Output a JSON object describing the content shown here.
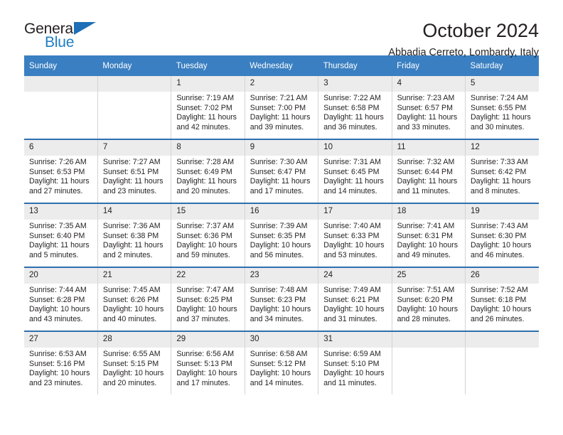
{
  "brand": {
    "name_top": "General",
    "name_bottom": "Blue",
    "triangle_color": "#1d6fb7",
    "blue_text_color": "#1d7ec4"
  },
  "header": {
    "title": "October 2024",
    "subtitle": "Abbadia Cerreto, Lombardy, Italy"
  },
  "colors": {
    "header_row_bg": "#3a7fc1",
    "header_row_text": "#ffffff",
    "daynum_bg": "#ececec",
    "row_divider": "#2f6fae",
    "text": "#231f20"
  },
  "weekday_headers": [
    "Sunday",
    "Monday",
    "Tuesday",
    "Wednesday",
    "Thursday",
    "Friday",
    "Saturday"
  ],
  "labels": {
    "sunrise_prefix": "Sunrise:",
    "sunset_prefix": "Sunset:",
    "daylight_prefix": "Daylight:"
  },
  "weeks": [
    [
      {
        "day": "",
        "lines": []
      },
      {
        "day": "",
        "lines": []
      },
      {
        "day": "1",
        "lines": [
          "Sunrise: 7:19 AM",
          "Sunset: 7:02 PM",
          "Daylight: 11 hours and 42 minutes."
        ]
      },
      {
        "day": "2",
        "lines": [
          "Sunrise: 7:21 AM",
          "Sunset: 7:00 PM",
          "Daylight: 11 hours and 39 minutes."
        ]
      },
      {
        "day": "3",
        "lines": [
          "Sunrise: 7:22 AM",
          "Sunset: 6:58 PM",
          "Daylight: 11 hours and 36 minutes."
        ]
      },
      {
        "day": "4",
        "lines": [
          "Sunrise: 7:23 AM",
          "Sunset: 6:57 PM",
          "Daylight: 11 hours and 33 minutes."
        ]
      },
      {
        "day": "5",
        "lines": [
          "Sunrise: 7:24 AM",
          "Sunset: 6:55 PM",
          "Daylight: 11 hours and 30 minutes."
        ]
      }
    ],
    [
      {
        "day": "6",
        "lines": [
          "Sunrise: 7:26 AM",
          "Sunset: 6:53 PM",
          "Daylight: 11 hours and 27 minutes."
        ]
      },
      {
        "day": "7",
        "lines": [
          "Sunrise: 7:27 AM",
          "Sunset: 6:51 PM",
          "Daylight: 11 hours and 23 minutes."
        ]
      },
      {
        "day": "8",
        "lines": [
          "Sunrise: 7:28 AM",
          "Sunset: 6:49 PM",
          "Daylight: 11 hours and 20 minutes."
        ]
      },
      {
        "day": "9",
        "lines": [
          "Sunrise: 7:30 AM",
          "Sunset: 6:47 PM",
          "Daylight: 11 hours and 17 minutes."
        ]
      },
      {
        "day": "10",
        "lines": [
          "Sunrise: 7:31 AM",
          "Sunset: 6:45 PM",
          "Daylight: 11 hours and 14 minutes."
        ]
      },
      {
        "day": "11",
        "lines": [
          "Sunrise: 7:32 AM",
          "Sunset: 6:44 PM",
          "Daylight: 11 hours and 11 minutes."
        ]
      },
      {
        "day": "12",
        "lines": [
          "Sunrise: 7:33 AM",
          "Sunset: 6:42 PM",
          "Daylight: 11 hours and 8 minutes."
        ]
      }
    ],
    [
      {
        "day": "13",
        "lines": [
          "Sunrise: 7:35 AM",
          "Sunset: 6:40 PM",
          "Daylight: 11 hours and 5 minutes."
        ]
      },
      {
        "day": "14",
        "lines": [
          "Sunrise: 7:36 AM",
          "Sunset: 6:38 PM",
          "Daylight: 11 hours and 2 minutes."
        ]
      },
      {
        "day": "15",
        "lines": [
          "Sunrise: 7:37 AM",
          "Sunset: 6:36 PM",
          "Daylight: 10 hours and 59 minutes."
        ]
      },
      {
        "day": "16",
        "lines": [
          "Sunrise: 7:39 AM",
          "Sunset: 6:35 PM",
          "Daylight: 10 hours and 56 minutes."
        ]
      },
      {
        "day": "17",
        "lines": [
          "Sunrise: 7:40 AM",
          "Sunset: 6:33 PM",
          "Daylight: 10 hours and 53 minutes."
        ]
      },
      {
        "day": "18",
        "lines": [
          "Sunrise: 7:41 AM",
          "Sunset: 6:31 PM",
          "Daylight: 10 hours and 49 minutes."
        ]
      },
      {
        "day": "19",
        "lines": [
          "Sunrise: 7:43 AM",
          "Sunset: 6:30 PM",
          "Daylight: 10 hours and 46 minutes."
        ]
      }
    ],
    [
      {
        "day": "20",
        "lines": [
          "Sunrise: 7:44 AM",
          "Sunset: 6:28 PM",
          "Daylight: 10 hours and 43 minutes."
        ]
      },
      {
        "day": "21",
        "lines": [
          "Sunrise: 7:45 AM",
          "Sunset: 6:26 PM",
          "Daylight: 10 hours and 40 minutes."
        ]
      },
      {
        "day": "22",
        "lines": [
          "Sunrise: 7:47 AM",
          "Sunset: 6:25 PM",
          "Daylight: 10 hours and 37 minutes."
        ]
      },
      {
        "day": "23",
        "lines": [
          "Sunrise: 7:48 AM",
          "Sunset: 6:23 PM",
          "Daylight: 10 hours and 34 minutes."
        ]
      },
      {
        "day": "24",
        "lines": [
          "Sunrise: 7:49 AM",
          "Sunset: 6:21 PM",
          "Daylight: 10 hours and 31 minutes."
        ]
      },
      {
        "day": "25",
        "lines": [
          "Sunrise: 7:51 AM",
          "Sunset: 6:20 PM",
          "Daylight: 10 hours and 28 minutes."
        ]
      },
      {
        "day": "26",
        "lines": [
          "Sunrise: 7:52 AM",
          "Sunset: 6:18 PM",
          "Daylight: 10 hours and 26 minutes."
        ]
      }
    ],
    [
      {
        "day": "27",
        "lines": [
          "Sunrise: 6:53 AM",
          "Sunset: 5:16 PM",
          "Daylight: 10 hours and 23 minutes."
        ]
      },
      {
        "day": "28",
        "lines": [
          "Sunrise: 6:55 AM",
          "Sunset: 5:15 PM",
          "Daylight: 10 hours and 20 minutes."
        ]
      },
      {
        "day": "29",
        "lines": [
          "Sunrise: 6:56 AM",
          "Sunset: 5:13 PM",
          "Daylight: 10 hours and 17 minutes."
        ]
      },
      {
        "day": "30",
        "lines": [
          "Sunrise: 6:58 AM",
          "Sunset: 5:12 PM",
          "Daylight: 10 hours and 14 minutes."
        ]
      },
      {
        "day": "31",
        "lines": [
          "Sunrise: 6:59 AM",
          "Sunset: 5:10 PM",
          "Daylight: 10 hours and 11 minutes."
        ]
      },
      {
        "day": "",
        "lines": []
      },
      {
        "day": "",
        "lines": []
      }
    ]
  ]
}
